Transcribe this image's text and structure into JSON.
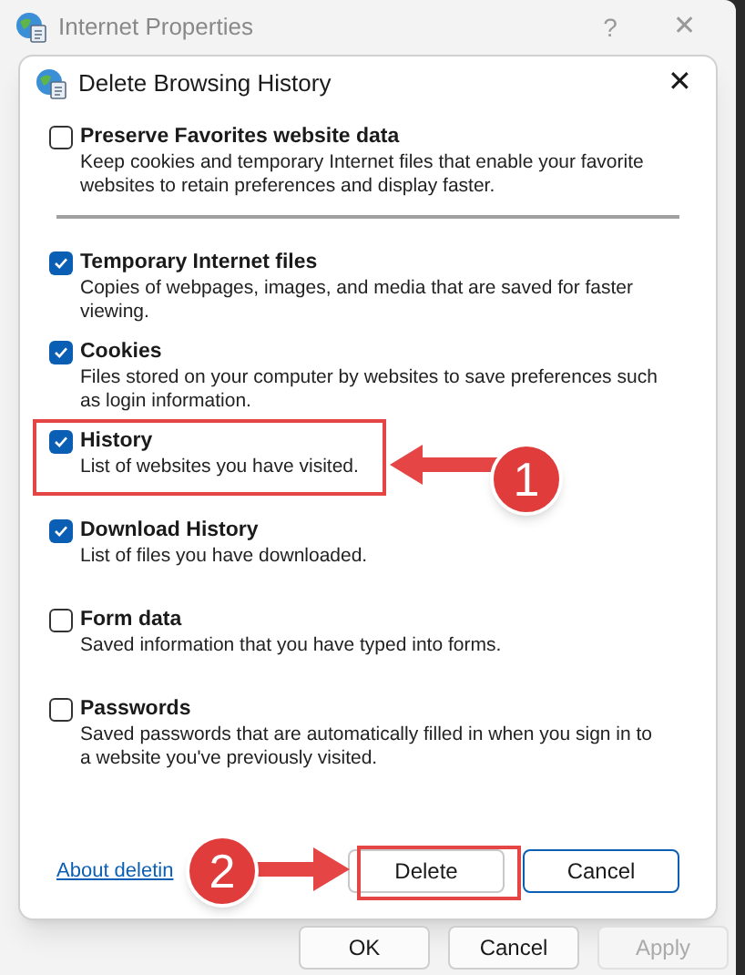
{
  "window": {
    "title": "Internet Properties",
    "help": "?",
    "close": "✕"
  },
  "dialog": {
    "title": "Delete Browsing History",
    "close": "✕",
    "options": [
      {
        "label": "Preserve Favorites website data",
        "description": "Keep cookies and temporary Internet files that enable your favorite websites to retain preferences and display faster.",
        "checked": false,
        "separator_after": true
      },
      {
        "label": "Temporary Internet files",
        "description": "Copies of webpages, images, and media that are saved for faster viewing.",
        "checked": true,
        "separator_after": false
      },
      {
        "label": "Cookies",
        "description": "Files stored on your computer by websites to save preferences such as login information.",
        "checked": true,
        "separator_after": false
      },
      {
        "label": "History",
        "description": "List of websites you have visited.",
        "checked": true,
        "separator_after": false
      },
      {
        "label": "Download History",
        "description": "List of files you have downloaded.",
        "checked": true,
        "separator_after": false
      },
      {
        "label": "Form data",
        "description": "Saved information that you have typed into forms.",
        "checked": false,
        "separator_after": false
      },
      {
        "label": "Passwords",
        "description": "Saved passwords that are automatically filled in when you sign in to a website you've previously visited.",
        "checked": false,
        "separator_after": false
      }
    ],
    "link": "About deletin",
    "buttons": [
      {
        "label": "Delete",
        "kind": "default"
      },
      {
        "label": "Cancel",
        "kind": "focused"
      }
    ]
  },
  "window_buttons": [
    {
      "label": "OK",
      "disabled": false
    },
    {
      "label": "Cancel",
      "disabled": false
    },
    {
      "label": "Apply",
      "disabled": true
    }
  ],
  "annotations": [
    {
      "kind": "callout",
      "label": "1"
    },
    {
      "kind": "callout",
      "label": "2"
    }
  ]
}
